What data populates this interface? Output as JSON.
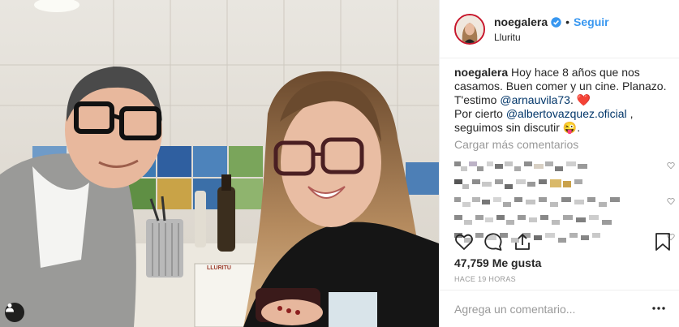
{
  "header": {
    "username": "noegalera",
    "separator": "•",
    "follow_label": "Seguir",
    "location": "Lluritu"
  },
  "caption": {
    "username": "noegalera",
    "line1": "Hoy hace 8 años que nos",
    "line2": "casamos. Buen comer y un cine. Planazo.",
    "line3_prefix": "T'estimo",
    "mention1": "@arnauvila73",
    "line3_suffix": ".",
    "emoji_heart": "❤️",
    "line4_prefix": "Por cierto",
    "mention2": "@albertovazquez.oficial",
    "line4_suffix": ",",
    "line5": "seguimos sin discutir",
    "emoji_wink": "😜",
    "line5_suffix": "."
  },
  "load_more_label": "Cargar más comentarios",
  "likes_text": "47,759 Me gusta",
  "time_text": "HACE 19 HORAS",
  "comment_placeholder": "Agrega un comentario...",
  "icons": {
    "like": "heart-icon",
    "comment": "comment-icon",
    "share": "share-icon",
    "save": "bookmark-icon",
    "more": "more-options-icon",
    "tag": "user-tag-icon",
    "verified": "verified-badge-icon"
  },
  "colors": {
    "link": "#3897f0",
    "mention": "#003569",
    "muted": "#999999",
    "text": "#262626",
    "heart": "#ed4956"
  }
}
